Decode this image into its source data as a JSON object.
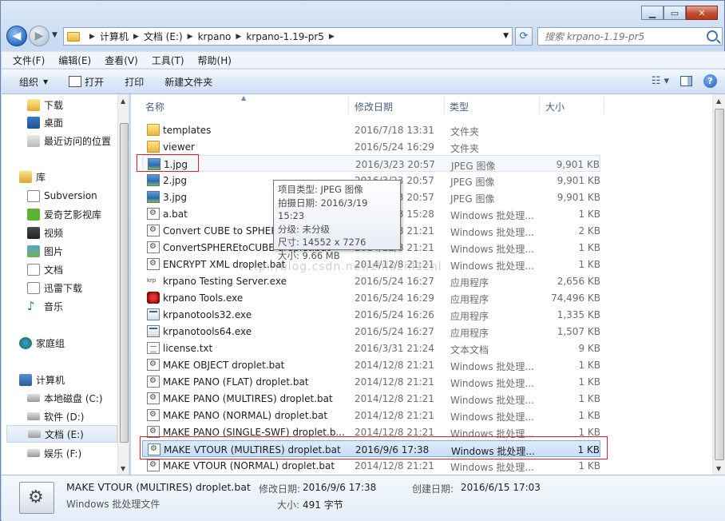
{
  "address": {
    "crumbs": [
      "计算机",
      "文档 (E:)",
      "krpano",
      "krpano-1.19-pr5"
    ]
  },
  "search": {
    "placeholder": "搜索 krpano-1.19-pr5"
  },
  "menu": [
    "文件(F)",
    "编辑(E)",
    "查看(V)",
    "工具(T)",
    "帮助(H)"
  ],
  "toolbar": {
    "organize": "组织",
    "open": "打开",
    "print": "打印",
    "new_folder": "新建文件夹"
  },
  "nav": {
    "items": [
      {
        "label": "下载",
        "icon": "download-folder-icon"
      },
      {
        "label": "桌面",
        "icon": "desktop-icon"
      },
      {
        "label": "最近访问的位置",
        "icon": "recent-places-icon"
      },
      {
        "label": "库",
        "icon": "library-icon"
      },
      {
        "label": "Subversion",
        "icon": "document-library-icon"
      },
      {
        "label": "爱奇艺影视库",
        "icon": "video-library-icon"
      },
      {
        "label": "视频",
        "icon": "video-icon"
      },
      {
        "label": "图片",
        "icon": "pictures-icon"
      },
      {
        "label": "文档",
        "icon": "documents-icon"
      },
      {
        "label": "迅雷下载",
        "icon": "thunder-download-icon"
      },
      {
        "label": "音乐",
        "icon": "music-icon"
      },
      {
        "label": "家庭组",
        "icon": "homegroup-icon"
      },
      {
        "label": "计算机",
        "icon": "computer-icon"
      },
      {
        "label": "本地磁盘 (C:)",
        "icon": "drive-c-icon"
      },
      {
        "label": "软件 (D:)",
        "icon": "drive-d-icon"
      },
      {
        "label": "文档 (E:)",
        "icon": "drive-e-icon"
      },
      {
        "label": "娱乐 (F:)",
        "icon": "drive-f-icon"
      }
    ]
  },
  "columns": {
    "name": "名称",
    "date": "修改日期",
    "type": "类型",
    "size": "大小"
  },
  "files": [
    {
      "name": "templates",
      "date": "2016/7/18 13:31",
      "type": "文件夹",
      "size": "",
      "icon": "folder"
    },
    {
      "name": "viewer",
      "date": "2016/5/24 16:29",
      "type": "文件夹",
      "size": "",
      "icon": "folder"
    },
    {
      "name": "1.jpg",
      "date": "2016/3/23 20:57",
      "type": "JPEG 图像",
      "size": "9,901 KB",
      "icon": "img"
    },
    {
      "name": "2.jpg",
      "date": "2016/3/23 20:57",
      "type": "JPEG 图像",
      "size": "9,901 KB",
      "icon": "img"
    },
    {
      "name": "3.jpg",
      "date": "2016/3/23 20:57",
      "type": "JPEG 图像",
      "size": "9,901 KB",
      "icon": "img"
    },
    {
      "name": "a.bat",
      "date": "2016/3/23 15:28",
      "type": "Windows 批处理...",
      "size": "1 KB",
      "icon": "bat"
    },
    {
      "name": "Convert CUBE to SPHERE droplet.bat",
      "date": "2014/12/8 21:21",
      "type": "Windows 批处理...",
      "size": "2 KB",
      "icon": "bat"
    },
    {
      "name": "ConvertSPHEREtoCUBE droplet.bat",
      "date": "2014/12/8 21:21",
      "type": "Windows 批处理...",
      "size": "1 KB",
      "icon": "bat"
    },
    {
      "name": "ENCRYPT XML droplet.bat",
      "date": "2014/12/8 21:21",
      "type": "Windows 批处理...",
      "size": "1 KB",
      "icon": "bat"
    },
    {
      "name": "krpano Testing Server.exe",
      "date": "2016/5/24 16:27",
      "type": "应用程序",
      "size": "2,656 KB",
      "icon": "krp"
    },
    {
      "name": "krpano Tools.exe",
      "date": "2016/5/24 16:29",
      "type": "应用程序",
      "size": "74,496 KB",
      "icon": "tools"
    },
    {
      "name": "krpanotools32.exe",
      "date": "2016/5/24 16:26",
      "type": "应用程序",
      "size": "1,335 KB",
      "icon": "exe"
    },
    {
      "name": "krpanotools64.exe",
      "date": "2016/5/24 16:27",
      "type": "应用程序",
      "size": "1,507 KB",
      "icon": "exe"
    },
    {
      "name": "license.txt",
      "date": "2016/3/31 21:24",
      "type": "文本文档",
      "size": "9 KB",
      "icon": "txt"
    },
    {
      "name": "MAKE OBJECT droplet.bat",
      "date": "2014/12/8 21:21",
      "type": "Windows 批处理...",
      "size": "1 KB",
      "icon": "bat"
    },
    {
      "name": "MAKE PANO (FLAT) droplet.bat",
      "date": "2014/12/8 21:21",
      "type": "Windows 批处理...",
      "size": "1 KB",
      "icon": "bat"
    },
    {
      "name": "MAKE PANO (MULTIRES) droplet.bat",
      "date": "2014/12/8 21:21",
      "type": "Windows 批处理...",
      "size": "1 KB",
      "icon": "bat"
    },
    {
      "name": "MAKE PANO (NORMAL) droplet.bat",
      "date": "2014/12/8 21:21",
      "type": "Windows 批处理...",
      "size": "1 KB",
      "icon": "bat"
    },
    {
      "name": "MAKE PANO (SINGLE-SWF) droplet.b...",
      "date": "2014/12/8 21:21",
      "type": "Windows 批处理...",
      "size": "1 KB",
      "icon": "bat"
    },
    {
      "name": "MAKE VTOUR (MULTIRES) droplet.bat",
      "date": "2016/9/6 17:38",
      "type": "Windows 批处理...",
      "size": "1 KB",
      "icon": "bat"
    },
    {
      "name": "MAKE VTOUR (NORMAL) droplet.bat",
      "date": "2014/12/8 21:21",
      "type": "Windows 批处理...",
      "size": "1 KB",
      "icon": "bat"
    }
  ],
  "tooltip": {
    "line1": "项目类型: JPEG 图像",
    "line2": "拍摄日期: 2016/3/19 15:23",
    "line3": "分级: 未分级",
    "line4": "尺寸: 14552 x 7276",
    "line5": "大小: 9.66 MB"
  },
  "watermark": "http://blog.csdn.net/zhl8zhl1zhl",
  "details": {
    "name": "MAKE VTOUR (MULTIRES) droplet.bat",
    "type": "Windows 批处理文件",
    "modified_label": "修改日期:",
    "modified_value": "2016/9/6 17:38",
    "created_label": "创建日期:",
    "created_value": "2016/6/15 17:03",
    "size_label": "大小:",
    "size_value": "491 字节"
  }
}
